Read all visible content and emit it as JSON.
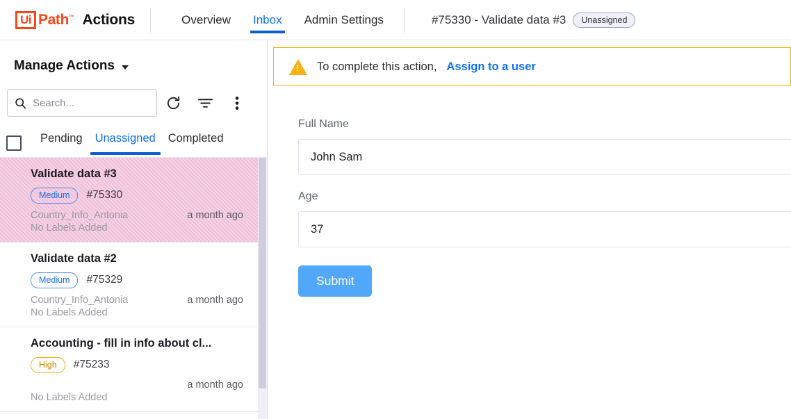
{
  "header": {
    "logo_mark": "Ui",
    "logo_word": "Path",
    "app_name": "Actions",
    "nav": [
      {
        "label": "Overview",
        "active": false
      },
      {
        "label": "Inbox",
        "active": true
      },
      {
        "label": "Admin Settings",
        "active": false
      }
    ],
    "context_title": "#75330 - Validate data #3",
    "context_status": "Unassigned"
  },
  "sidebar": {
    "title": "Manage Actions",
    "dropdown_icon": "chevron-down-icon",
    "search": {
      "placeholder": "Search...",
      "value": "",
      "icon": "search-icon"
    },
    "toolbar_icons": [
      {
        "name": "refresh-icon",
        "glyph": "refresh"
      },
      {
        "name": "filter-icon",
        "glyph": "filter"
      },
      {
        "name": "more-options-icon",
        "glyph": "kebab"
      }
    ],
    "select_all_checked": false,
    "tabs": [
      {
        "label": "Pending",
        "active": false
      },
      {
        "label": "Unassigned",
        "active": true
      },
      {
        "label": "Completed",
        "active": false
      }
    ],
    "items": [
      {
        "title": "Validate data #3",
        "priority": "Medium",
        "priority_level": "medium",
        "reference": "#75330",
        "app": "Country_Info_Antonia",
        "time": "a month ago",
        "labels": "No Labels Added",
        "selected": true
      },
      {
        "title": "Validate data #2",
        "priority": "Medium",
        "priority_level": "medium",
        "reference": "#75329",
        "app": "Country_Info_Antonia",
        "time": "a month ago",
        "labels": "No Labels Added",
        "selected": false
      },
      {
        "title": "Accounting - fill in info about cl...",
        "priority": "High",
        "priority_level": "high",
        "reference": "#75233",
        "app": "",
        "time": "a month ago",
        "labels": "No Labels Added",
        "selected": false
      }
    ]
  },
  "main": {
    "banner": {
      "icon": "warning-triangle-icon",
      "text": "To complete this action,",
      "link": "Assign to a user"
    },
    "form": {
      "fields": [
        {
          "label": "Full Name",
          "value": "John Sam"
        },
        {
          "label": "Age",
          "value": "37"
        }
      ],
      "submit_label": "Submit"
    }
  },
  "colors": {
    "brand": "#fa4616",
    "accent_blue": "#0d6efd",
    "warning": "#f2b705",
    "submit_blue": "#51a7f9",
    "selected_row": "#fbeef5"
  }
}
